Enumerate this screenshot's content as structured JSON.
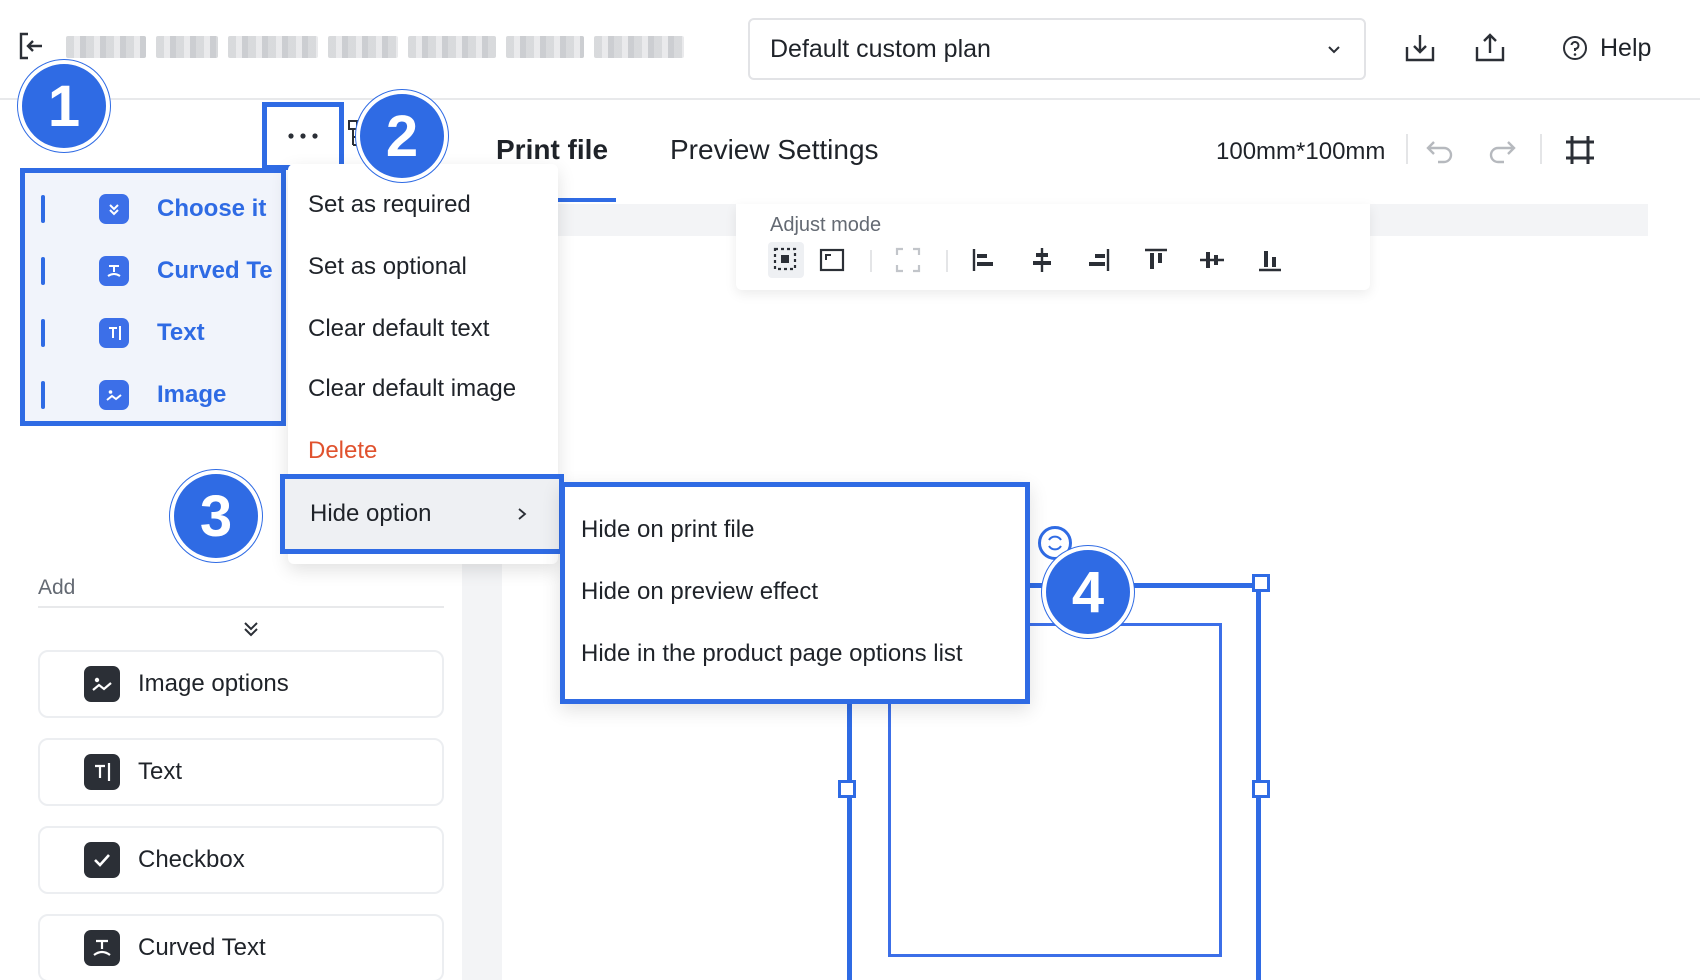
{
  "header": {
    "plan_select_value": "Default custom plan",
    "help_label": "Help"
  },
  "layers": {
    "items": [
      {
        "label": "Choose it",
        "icon": "dropdown-icon"
      },
      {
        "label": "Curved Te",
        "icon": "curved-text-icon"
      },
      {
        "label": "Text",
        "icon": "text-icon"
      },
      {
        "label": "Image",
        "icon": "image-icon"
      }
    ]
  },
  "context_menu": {
    "items": [
      {
        "label": "Set as required"
      },
      {
        "label": "Set as optional"
      },
      {
        "label": "Clear default text"
      },
      {
        "label": "Clear default image"
      },
      {
        "label": "Delete"
      },
      {
        "label": "Hide option"
      }
    ]
  },
  "hide_submenu": {
    "items": [
      {
        "label": "Hide on print file"
      },
      {
        "label": "Hide on preview effect"
      },
      {
        "label": "Hide in the product page options list"
      }
    ]
  },
  "add_section": {
    "label": "Add",
    "cards": [
      {
        "label": "Image options",
        "icon": "image-icon"
      },
      {
        "label": "Text",
        "icon": "text-icon"
      },
      {
        "label": "Checkbox",
        "icon": "checkbox-icon"
      },
      {
        "label": "Curved Text",
        "icon": "curved-text-icon"
      }
    ]
  },
  "canvas": {
    "tabs": [
      {
        "label": "Print file",
        "active": true
      },
      {
        "label": "Preview Settings",
        "active": false
      }
    ],
    "size_label": "100mm*100mm",
    "adjust_mode_label": "Adjust mode"
  },
  "badges": [
    "1",
    "2",
    "3",
    "4"
  ],
  "colors": {
    "accent": "#2f6be4",
    "danger": "#e0522e",
    "text": "#1f2329",
    "muted": "#646a73"
  }
}
